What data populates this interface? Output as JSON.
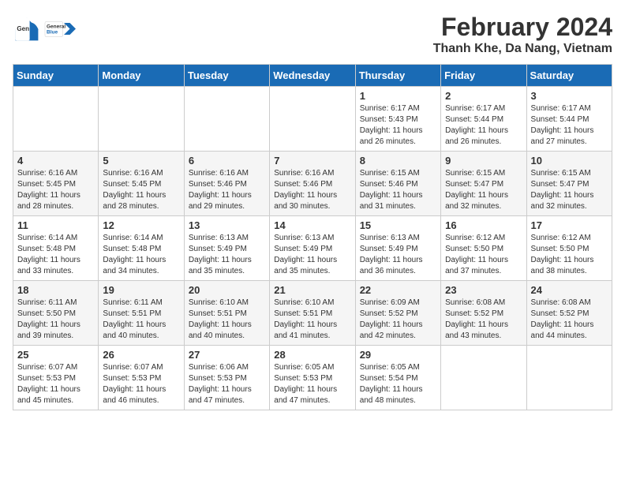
{
  "header": {
    "logo_general": "General",
    "logo_blue": "Blue",
    "month_title": "February 2024",
    "location": "Thanh Khe, Da Nang, Vietnam"
  },
  "weekdays": [
    "Sunday",
    "Monday",
    "Tuesday",
    "Wednesday",
    "Thursday",
    "Friday",
    "Saturday"
  ],
  "weeks": [
    [
      {
        "day": "",
        "info": ""
      },
      {
        "day": "",
        "info": ""
      },
      {
        "day": "",
        "info": ""
      },
      {
        "day": "",
        "info": ""
      },
      {
        "day": "1",
        "info": "Sunrise: 6:17 AM\nSunset: 5:43 PM\nDaylight: 11 hours\nand 26 minutes."
      },
      {
        "day": "2",
        "info": "Sunrise: 6:17 AM\nSunset: 5:44 PM\nDaylight: 11 hours\nand 26 minutes."
      },
      {
        "day": "3",
        "info": "Sunrise: 6:17 AM\nSunset: 5:44 PM\nDaylight: 11 hours\nand 27 minutes."
      }
    ],
    [
      {
        "day": "4",
        "info": "Sunrise: 6:16 AM\nSunset: 5:45 PM\nDaylight: 11 hours\nand 28 minutes."
      },
      {
        "day": "5",
        "info": "Sunrise: 6:16 AM\nSunset: 5:45 PM\nDaylight: 11 hours\nand 28 minutes."
      },
      {
        "day": "6",
        "info": "Sunrise: 6:16 AM\nSunset: 5:46 PM\nDaylight: 11 hours\nand 29 minutes."
      },
      {
        "day": "7",
        "info": "Sunrise: 6:16 AM\nSunset: 5:46 PM\nDaylight: 11 hours\nand 30 minutes."
      },
      {
        "day": "8",
        "info": "Sunrise: 6:15 AM\nSunset: 5:46 PM\nDaylight: 11 hours\nand 31 minutes."
      },
      {
        "day": "9",
        "info": "Sunrise: 6:15 AM\nSunset: 5:47 PM\nDaylight: 11 hours\nand 32 minutes."
      },
      {
        "day": "10",
        "info": "Sunrise: 6:15 AM\nSunset: 5:47 PM\nDaylight: 11 hours\nand 32 minutes."
      }
    ],
    [
      {
        "day": "11",
        "info": "Sunrise: 6:14 AM\nSunset: 5:48 PM\nDaylight: 11 hours\nand 33 minutes."
      },
      {
        "day": "12",
        "info": "Sunrise: 6:14 AM\nSunset: 5:48 PM\nDaylight: 11 hours\nand 34 minutes."
      },
      {
        "day": "13",
        "info": "Sunrise: 6:13 AM\nSunset: 5:49 PM\nDaylight: 11 hours\nand 35 minutes."
      },
      {
        "day": "14",
        "info": "Sunrise: 6:13 AM\nSunset: 5:49 PM\nDaylight: 11 hours\nand 35 minutes."
      },
      {
        "day": "15",
        "info": "Sunrise: 6:13 AM\nSunset: 5:49 PM\nDaylight: 11 hours\nand 36 minutes."
      },
      {
        "day": "16",
        "info": "Sunrise: 6:12 AM\nSunset: 5:50 PM\nDaylight: 11 hours\nand 37 minutes."
      },
      {
        "day": "17",
        "info": "Sunrise: 6:12 AM\nSunset: 5:50 PM\nDaylight: 11 hours\nand 38 minutes."
      }
    ],
    [
      {
        "day": "18",
        "info": "Sunrise: 6:11 AM\nSunset: 5:50 PM\nDaylight: 11 hours\nand 39 minutes."
      },
      {
        "day": "19",
        "info": "Sunrise: 6:11 AM\nSunset: 5:51 PM\nDaylight: 11 hours\nand 40 minutes."
      },
      {
        "day": "20",
        "info": "Sunrise: 6:10 AM\nSunset: 5:51 PM\nDaylight: 11 hours\nand 40 minutes."
      },
      {
        "day": "21",
        "info": "Sunrise: 6:10 AM\nSunset: 5:51 PM\nDaylight: 11 hours\nand 41 minutes."
      },
      {
        "day": "22",
        "info": "Sunrise: 6:09 AM\nSunset: 5:52 PM\nDaylight: 11 hours\nand 42 minutes."
      },
      {
        "day": "23",
        "info": "Sunrise: 6:08 AM\nSunset: 5:52 PM\nDaylight: 11 hours\nand 43 minutes."
      },
      {
        "day": "24",
        "info": "Sunrise: 6:08 AM\nSunset: 5:52 PM\nDaylight: 11 hours\nand 44 minutes."
      }
    ],
    [
      {
        "day": "25",
        "info": "Sunrise: 6:07 AM\nSunset: 5:53 PM\nDaylight: 11 hours\nand 45 minutes."
      },
      {
        "day": "26",
        "info": "Sunrise: 6:07 AM\nSunset: 5:53 PM\nDaylight: 11 hours\nand 46 minutes."
      },
      {
        "day": "27",
        "info": "Sunrise: 6:06 AM\nSunset: 5:53 PM\nDaylight: 11 hours\nand 47 minutes."
      },
      {
        "day": "28",
        "info": "Sunrise: 6:05 AM\nSunset: 5:53 PM\nDaylight: 11 hours\nand 47 minutes."
      },
      {
        "day": "29",
        "info": "Sunrise: 6:05 AM\nSunset: 5:54 PM\nDaylight: 11 hours\nand 48 minutes."
      },
      {
        "day": "",
        "info": ""
      },
      {
        "day": "",
        "info": ""
      }
    ]
  ]
}
